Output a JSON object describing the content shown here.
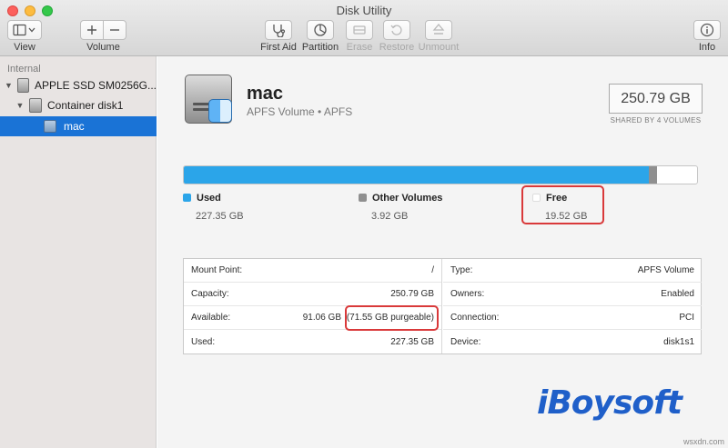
{
  "window": {
    "title": "Disk Utility"
  },
  "toolbar": {
    "view": "View",
    "volume": "Volume",
    "first_aid": "First Aid",
    "partition": "Partition",
    "erase": "Erase",
    "restore": "Restore",
    "unmount": "Unmount",
    "info": "Info"
  },
  "sidebar": {
    "section": "Internal",
    "items": [
      {
        "label": "APPLE SSD SM0256G...",
        "icon": "disk-icon"
      },
      {
        "label": "Container disk1",
        "icon": "disk-icon"
      },
      {
        "label": "mac",
        "icon": "volume-icon",
        "selected": true
      }
    ]
  },
  "volume": {
    "name": "mac",
    "subtitle": "APFS Volume • APFS",
    "capacity": "250.79 GB",
    "shared_note": "SHARED BY 4 VOLUMES"
  },
  "usage": {
    "used_fraction": 0.9066,
    "other_fraction": 0.0156,
    "colors": {
      "used": "#2ba5e9",
      "other": "#8f8f8f",
      "free": "#ffffff",
      "highlight": "#d9393a"
    },
    "legend": [
      {
        "label": "Used",
        "value": "227.35 GB"
      },
      {
        "label": "Other Volumes",
        "value": "3.92 GB"
      },
      {
        "label": "Free",
        "value": "19.52 GB"
      }
    ]
  },
  "info": {
    "left": [
      {
        "key": "Mount Point:",
        "value": "/"
      },
      {
        "key": "Capacity:",
        "value": "250.79 GB"
      },
      {
        "key": "Available:",
        "value": "91.06 GB",
        "extra": "(71.55 GB purgeable)"
      },
      {
        "key": "Used:",
        "value": "227.35 GB"
      }
    ],
    "right": [
      {
        "key": "Type:",
        "value": "APFS Volume"
      },
      {
        "key": "Owners:",
        "value": "Enabled"
      },
      {
        "key": "Connection:",
        "value": "PCI"
      },
      {
        "key": "Device:",
        "value": "disk1s1"
      }
    ]
  },
  "watermark": "iBoysoft",
  "site": "wsxdn.com"
}
